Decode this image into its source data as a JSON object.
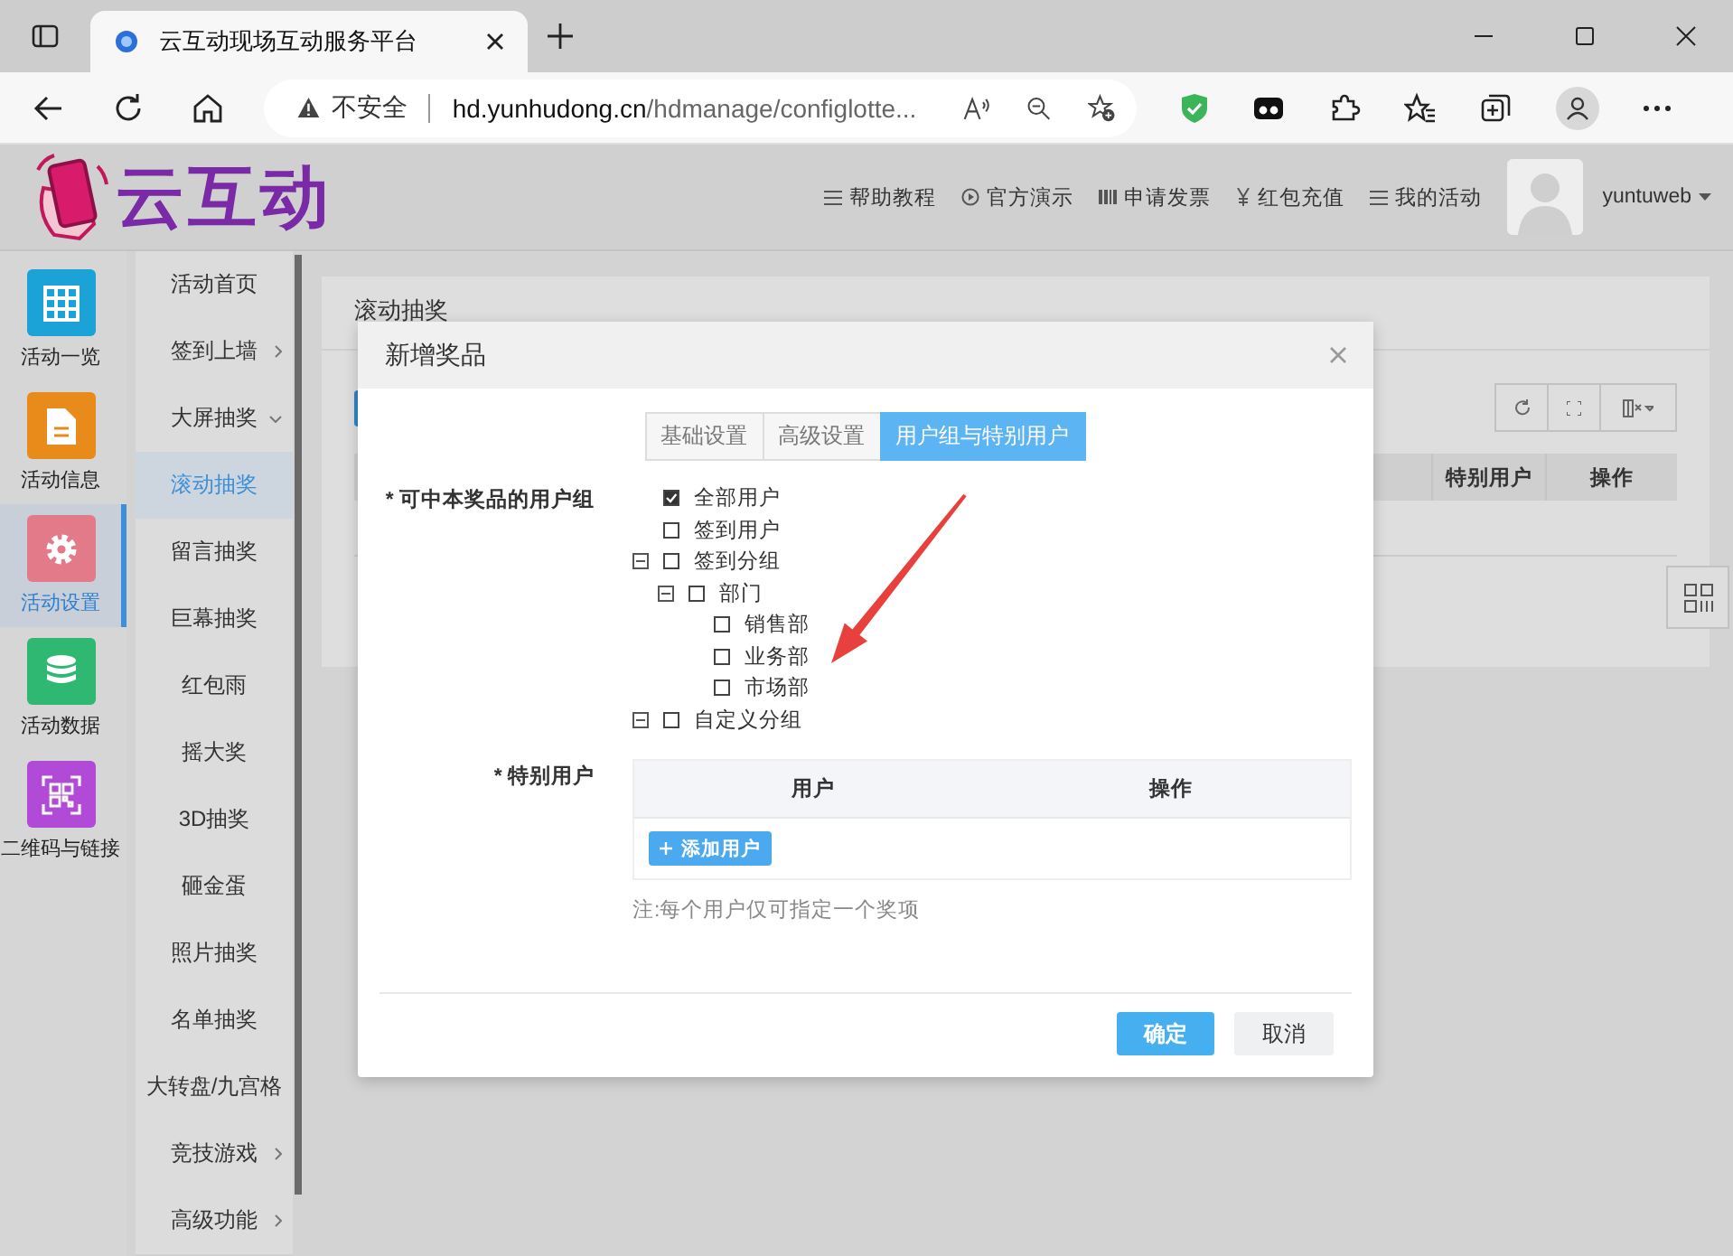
{
  "browser": {
    "tab_title": "云互动现场互动服务平台",
    "security_label": "不安全",
    "url_host": "hd.yunhudong.cn",
    "url_path": "/hdmanage/configlotte..."
  },
  "header": {
    "logo_text": "云互动",
    "nav": [
      {
        "kind": "list",
        "label": "帮助教程"
      },
      {
        "kind": "play",
        "label": "官方演示"
      },
      {
        "kind": "bars",
        "label": "申请发票"
      },
      {
        "kind": "yen",
        "label": "红包充值"
      },
      {
        "kind": "list",
        "label": "我的活动"
      }
    ],
    "username": "yuntuweb"
  },
  "sidebar": [
    {
      "kind": "grid",
      "label": "活动一览",
      "color": "#1ba3d8",
      "selected": false
    },
    {
      "kind": "doc",
      "label": "活动信息",
      "color": "#e88b1a",
      "selected": false
    },
    {
      "kind": "gear",
      "label": "活动设置",
      "color": "#e27a8a",
      "selected": true
    },
    {
      "kind": "database",
      "label": "活动数据",
      "color": "#2fb872",
      "selected": false
    },
    {
      "kind": "qr",
      "label": "二维码与链接",
      "color": "#b24ad8",
      "selected": false
    }
  ],
  "submenu": [
    {
      "label": "活动首页",
      "selected": false
    },
    {
      "label": "签到上墙",
      "expanded": false,
      "selected": false
    },
    {
      "label": "大屏抽奖",
      "expanded": true,
      "selected": false
    },
    {
      "label": "滚动抽奖",
      "selected": true
    },
    {
      "label": "留言抽奖",
      "selected": false
    },
    {
      "label": "巨幕抽奖",
      "selected": false
    },
    {
      "label": "红包雨",
      "selected": false
    },
    {
      "label": "摇大奖",
      "selected": false
    },
    {
      "label": "3D抽奖",
      "selected": false
    },
    {
      "label": "砸金蛋",
      "selected": false
    },
    {
      "label": "照片抽奖",
      "selected": false
    },
    {
      "label": "名单抽奖",
      "selected": false
    },
    {
      "label": "大转盘/九宫格",
      "selected": false
    },
    {
      "label": "竞技游戏",
      "expanded": false,
      "selected": false
    },
    {
      "label": "高级功能",
      "expanded": false,
      "selected": false
    }
  ],
  "page": {
    "title": "滚动抽奖",
    "table_columns": [
      "特别用户",
      "操作"
    ]
  },
  "modal": {
    "title": "新增奖品",
    "tabs": [
      {
        "label": "基础设置",
        "selected": false
      },
      {
        "label": "高级设置",
        "selected": false
      },
      {
        "label": "用户组与特别用户",
        "selected": true
      }
    ],
    "groups_label": "* 可中本奖品的用户组",
    "user_groups": [
      {
        "label": "全部用户",
        "checked": true
      },
      {
        "label": "签到用户",
        "checked": false
      },
      {
        "label": "签到分组",
        "checked": false,
        "expanded": true,
        "children": [
          {
            "label": "部门",
            "checked": false,
            "expanded": true,
            "children": [
              {
                "label": "销售部",
                "checked": false
              },
              {
                "label": "业务部",
                "checked": false
              },
              {
                "label": "市场部",
                "checked": false
              }
            ]
          }
        ]
      },
      {
        "label": "自定义分组",
        "checked": false,
        "expanded": true
      }
    ],
    "special_label": "* 特别用户",
    "special_columns": [
      "用户",
      "操作"
    ],
    "add_button": "添加用户",
    "note": "注:每个用户仅可指定一个奖项",
    "confirm": "确定",
    "cancel": "取消"
  }
}
